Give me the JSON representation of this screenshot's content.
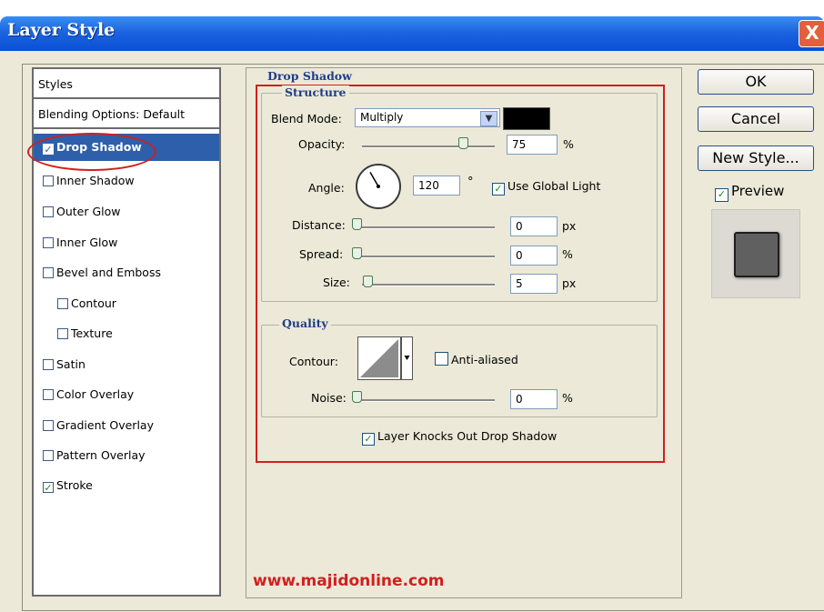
{
  "window": {
    "title": "Layer Style",
    "close_label": "X"
  },
  "styles_list": {
    "items": [
      {
        "label": "Styles",
        "checkbox": false,
        "checked": false,
        "active": false,
        "indent": false
      },
      {
        "label": "Blending Options: Default",
        "checkbox": false,
        "checked": false,
        "active": false,
        "indent": false
      },
      {
        "label": "Drop Shadow",
        "checkbox": true,
        "checked": true,
        "active": true,
        "indent": false
      },
      {
        "label": "Inner Shadow",
        "checkbox": true,
        "checked": false,
        "active": false,
        "indent": false
      },
      {
        "label": "Outer Glow",
        "checkbox": true,
        "checked": false,
        "active": false,
        "indent": false
      },
      {
        "label": "Inner Glow",
        "checkbox": true,
        "checked": false,
        "active": false,
        "indent": false
      },
      {
        "label": "Bevel and Emboss",
        "checkbox": true,
        "checked": false,
        "active": false,
        "indent": false
      },
      {
        "label": "Contour",
        "checkbox": true,
        "checked": false,
        "active": false,
        "indent": true
      },
      {
        "label": "Texture",
        "checkbox": true,
        "checked": false,
        "active": false,
        "indent": true
      },
      {
        "label": "Satin",
        "checkbox": true,
        "checked": false,
        "active": false,
        "indent": false
      },
      {
        "label": "Color Overlay",
        "checkbox": true,
        "checked": false,
        "active": false,
        "indent": false
      },
      {
        "label": "Gradient Overlay",
        "checkbox": true,
        "checked": false,
        "active": false,
        "indent": false
      },
      {
        "label": "Pattern Overlay",
        "checkbox": true,
        "checked": false,
        "active": false,
        "indent": false
      },
      {
        "label": "Stroke",
        "checkbox": true,
        "checked": true,
        "active": false,
        "indent": false
      }
    ]
  },
  "drop_shadow": {
    "section_title": "Drop Shadow",
    "structure": {
      "title": "Structure",
      "blend_mode_label": "Blend Mode:",
      "blend_mode_value": "Multiply",
      "shadow_color": "#000000",
      "opacity_label": "Opacity:",
      "opacity_value": "75",
      "opacity_level": 75,
      "opacity_unit": "%",
      "angle_label": "Angle:",
      "angle_value": "120",
      "angle_unit": "°",
      "use_global_light_label": "Use Global Light",
      "use_global_light_checked": true,
      "distance_label": "Distance:",
      "distance_value": "0",
      "distance_unit": "px",
      "spread_label": "Spread:",
      "spread_value": "0",
      "spread_unit": "%",
      "size_label": "Size:",
      "size_value": "5",
      "size_unit": "px"
    },
    "quality": {
      "title": "Quality",
      "contour_label": "Contour:",
      "anti_aliased_label": "Anti-aliased",
      "anti_aliased_checked": false,
      "noise_label": "Noise:",
      "noise_value": "0",
      "noise_unit": "%"
    },
    "knocks_out_label": "Layer Knocks Out Drop Shadow",
    "knocks_out_checked": true
  },
  "buttons": {
    "ok": "OK",
    "cancel": "Cancel",
    "new_style": "New Style..."
  },
  "preview": {
    "label": "Preview",
    "checked": true
  },
  "watermark": "www.majidonline.com",
  "colors": {
    "accent_selection": "#2e5faa",
    "annotation_red": "#d21f1f",
    "titlebar_blue": "#0a4fd6"
  }
}
